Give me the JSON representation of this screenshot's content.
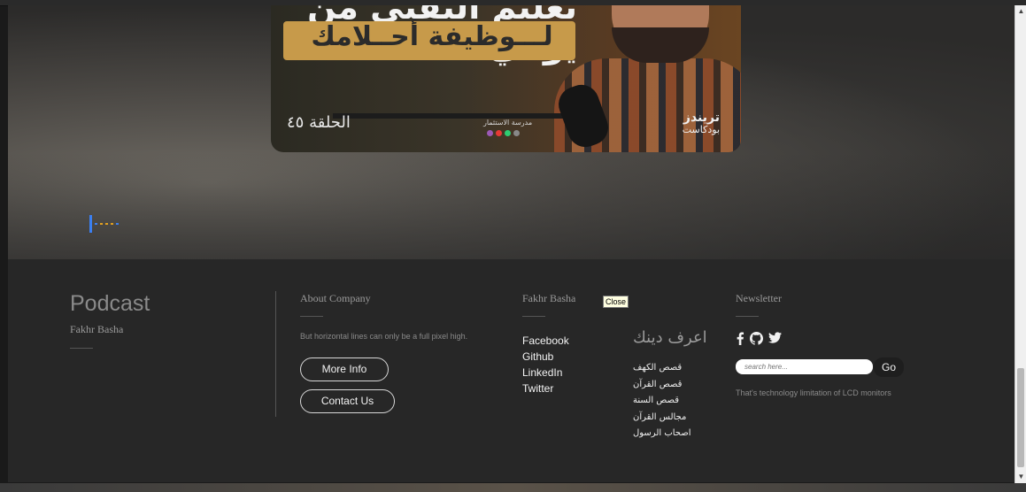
{
  "hero": {
    "video": {
      "title_line1": "تعليم التقني من يومي",
      "title_line2": "لـــوظيفة أحــلامك",
      "episode": "الحلقة ٤٥",
      "brand": "تريندز",
      "brand_sub": "بودكاست",
      "school": "مدرسة الاستثمار"
    },
    "loader_colors": [
      "#3b7ff0",
      "#e0a020",
      "#e04040",
      "#30a060",
      "#3b7ff0"
    ]
  },
  "footer": {
    "podcast": {
      "title": "Podcast",
      "subtitle": "Fakhr Basha"
    },
    "about": {
      "heading": "About Company",
      "text": "But horizontal lines can only be a full pixel high.",
      "more_info": "More Info",
      "contact_us": "Contact Us"
    },
    "fakhr": {
      "heading": "Fakhr Basha",
      "links": [
        "Facebook",
        "Github",
        "LinkedIn",
        "Twitter"
      ]
    },
    "tooltip": "Close",
    "arabic": {
      "heading": "اعرف دينك",
      "links": [
        "قصص الكهف",
        "قصص القرآن",
        "قصص السنة",
        "مجالس القرآن",
        "اصحاب الرسول"
      ]
    },
    "newsletter": {
      "heading": "Newsletter",
      "social_icons": [
        "facebook-icon",
        "github-icon",
        "twitter-icon"
      ],
      "search_placeholder": "search here...",
      "go_label": "Go",
      "text": "That's technology limitation of LCD monitors"
    }
  }
}
